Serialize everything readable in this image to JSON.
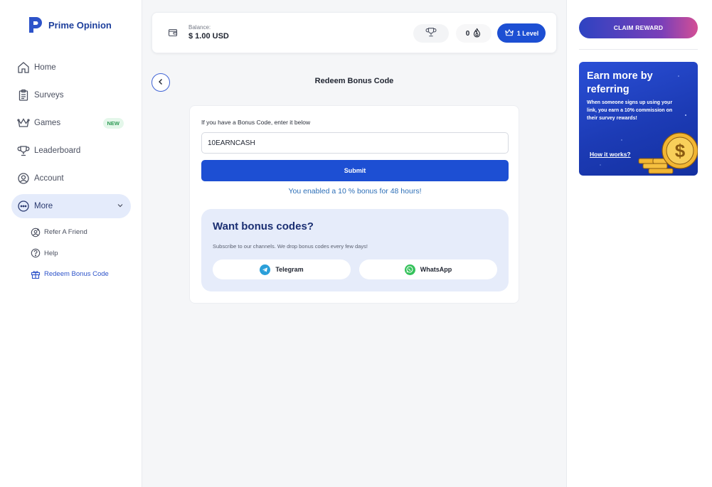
{
  "brand": {
    "name": "Prime Opinion"
  },
  "sidebar": {
    "items": [
      {
        "label": "Home",
        "icon": "home-icon"
      },
      {
        "label": "Surveys",
        "icon": "clipboard-icon"
      },
      {
        "label": "Games",
        "icon": "crown-icon",
        "badge": "NEW"
      },
      {
        "label": "Leaderboard",
        "icon": "trophy-icon"
      },
      {
        "label": "Account",
        "icon": "user-circle-icon"
      },
      {
        "label": "More",
        "icon": "more-icon"
      }
    ],
    "subitems": [
      {
        "label": "Refer A Friend",
        "icon": "refer-icon"
      },
      {
        "label": "Help",
        "icon": "help-icon"
      },
      {
        "label": "Redeem Bonus Code",
        "icon": "gift-icon"
      }
    ]
  },
  "header": {
    "balance_label": "Balance:",
    "balance_value": "$ 1.00 USD",
    "streak_count": "0",
    "level_label": "1 Level"
  },
  "page": {
    "title": "Redeem Bonus Code"
  },
  "redeem": {
    "hint": "If you have a Bonus Code, enter it below",
    "code_value": "10EARNCASH",
    "submit_label": "Submit",
    "success_message": "You enabled a 10 % bonus for 48 hours!"
  },
  "promo": {
    "title": "Want bonus codes?",
    "subtitle": "Subscribe to our channels. We drop bonus codes every few days!",
    "telegram_label": "Telegram",
    "whatsapp_label": "WhatsApp"
  },
  "rightpanel": {
    "claim_label": "CLAIM REWARD",
    "refer_title": "Earn more by referring",
    "refer_body": "When someone signs up using your link, you earn a 10% commission on their survey rewards!",
    "refer_link": "How it works?"
  },
  "colors": {
    "primary": "#1d4fd3",
    "brand": "#1d3f9c",
    "success_text": "#2d6fb7",
    "promo_bg": "#e6ecfa",
    "telegram": "#2a9fd9",
    "whatsapp": "#35c25b"
  }
}
